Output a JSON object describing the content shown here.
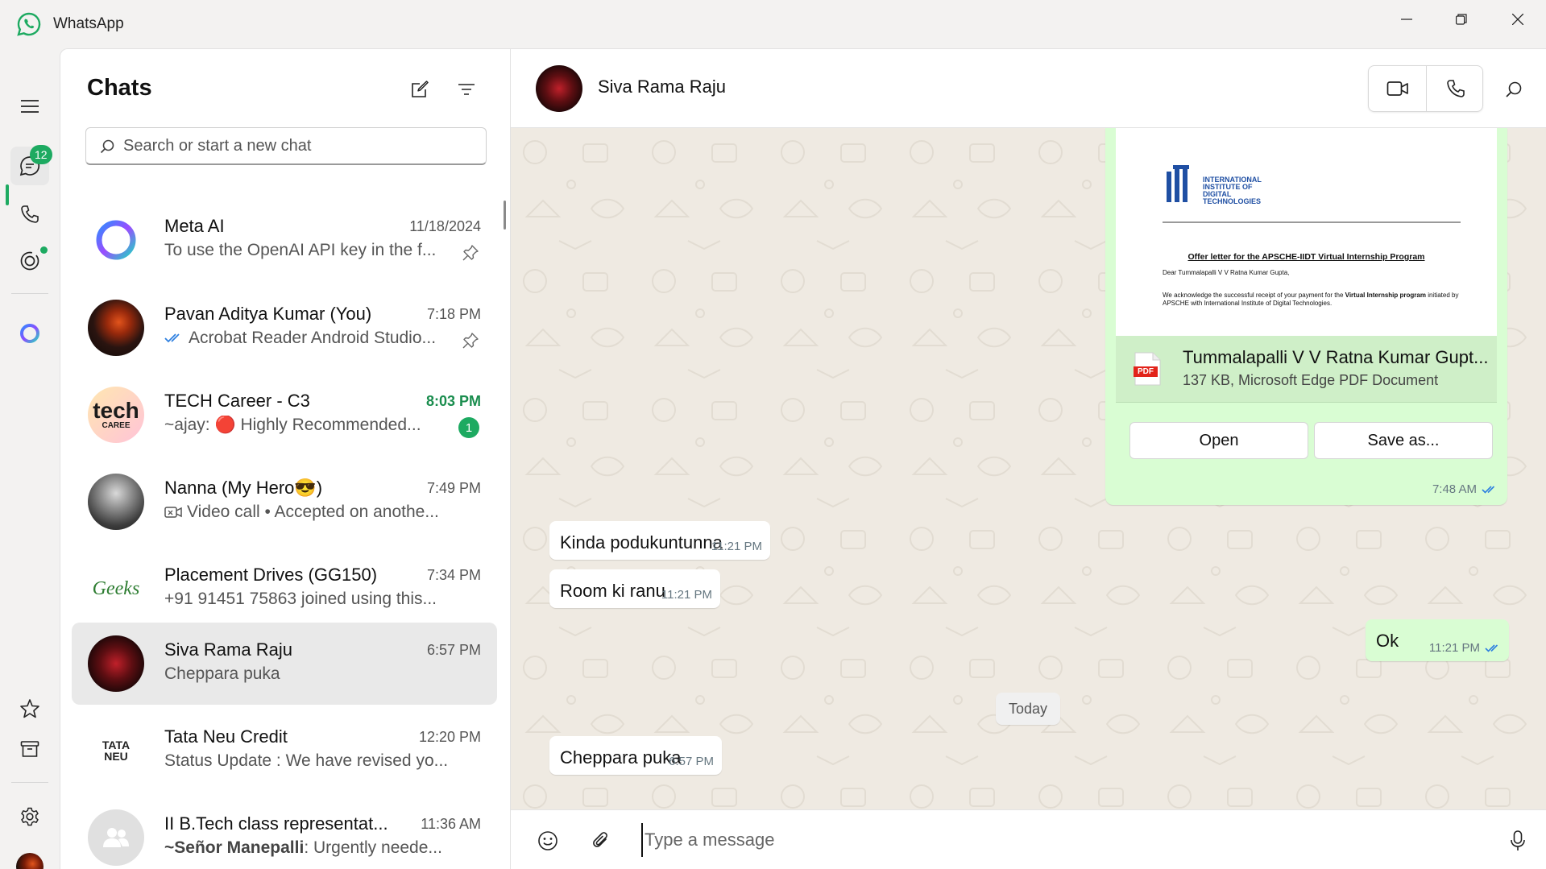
{
  "window": {
    "title": "WhatsApp",
    "controls": [
      "minimize",
      "maximize",
      "close"
    ]
  },
  "rail": {
    "chats_badge": "12",
    "items": [
      "menu-icon",
      "chats-icon",
      "calls-icon",
      "status-icon",
      "meta-ai-icon",
      "starred-icon",
      "archived-icon",
      "settings-icon",
      "profile-avatar"
    ]
  },
  "chatlist": {
    "title": "Chats",
    "search_placeholder": "Search or start a new chat",
    "chats": [
      {
        "name": "Meta AI",
        "time": "11/18/2024",
        "preview": "To use the OpenAI API key in the f...",
        "pinned": true
      },
      {
        "name": "Pavan Aditya Kumar (You)",
        "time": "7:18 PM",
        "preview": "Acrobat Reader Android Studio...",
        "pinned": true,
        "read_ticks": true
      },
      {
        "name": "TECH Career - C3",
        "time": "8:03 PM",
        "preview": "~ajay: 🔴 Highly Recommended...",
        "unread": "1",
        "avatar_text": "tech",
        "avatar_sub": "CAREE"
      },
      {
        "name": "Nanna (My Hero😎)",
        "time": "7:49 PM",
        "preview": "Video call • Accepted on anothe..."
      },
      {
        "name": "Placement Drives (GG150)",
        "time": "7:34 PM",
        "preview": "+91 91451 75863 joined using this...",
        "avatar_text": "Geeks"
      },
      {
        "name": "Siva Rama Raju",
        "time": "6:57 PM",
        "preview": "Cheppara puka",
        "selected": true
      },
      {
        "name": "Tata Neu Credit",
        "time": "12:20 PM",
        "preview": "Status Update : We have revised yo...",
        "avatar_text": "TATA NEU"
      },
      {
        "name": "II B.Tech class representat...",
        "time": "11:36 AM",
        "preview_sender": "~Señor Manepalli",
        "preview": ": Urgently neede..."
      }
    ]
  },
  "conversation": {
    "contact_name": "Siva Rama Raju",
    "document": {
      "logo_text": [
        "INTERNATIONAL",
        "INSTITUTE OF",
        "DIGITAL",
        "TECHNOLOGIES"
      ],
      "preview_title": "Offer letter for the APSCHE-IIDT Virtual Internship Program",
      "preview_greeting": "Dear Tummalapalli V V Ratna Kumar Gupta,",
      "preview_body_1": "We acknowledge the successful receipt of your payment for the ",
      "preview_body_bold_1": "Virtual Internship",
      "preview_body_bold_2": "program",
      "preview_body_2": " initiated by APSCHE with International Institute of Digital Technologies.",
      "pdf_label": "PDF",
      "file_name": "Tummalapalli V V Ratna Kumar Gupt...",
      "file_meta": "137 KB, Microsoft Edge PDF Document",
      "open_label": "Open",
      "save_label": "Save as...",
      "time": "7:48 AM"
    },
    "messages": [
      {
        "dir": "in",
        "text": "Kinda podukuntunna",
        "time": "11:21 PM"
      },
      {
        "dir": "in",
        "text": "Room ki ranu",
        "time": "11:21 PM"
      },
      {
        "dir": "out",
        "text": "Ok",
        "time": "11:21 PM"
      },
      {
        "dir": "in",
        "text": "Cheppara puka",
        "time": "6:57 PM"
      }
    ],
    "date_divider": "Today",
    "composer_placeholder": "Type a message"
  },
  "colors": {
    "accent": "#1daa61",
    "outgoing_bubble": "#d9fdd3",
    "chat_bg": "#efeae2",
    "tick_blue": "#53bdeb"
  }
}
